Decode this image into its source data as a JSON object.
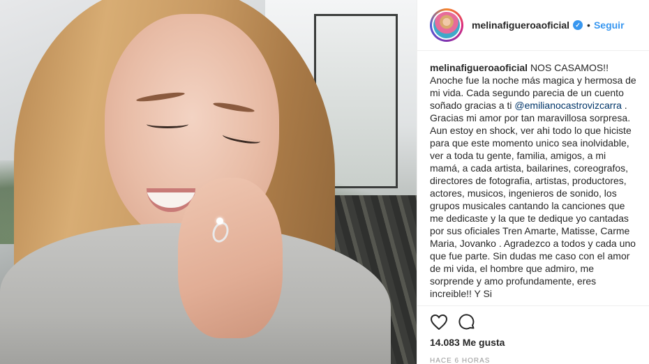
{
  "post": {
    "username": "melinafigueroaoficial",
    "verified_badge": "verified-check-icon",
    "separator": "•",
    "follow_label": "Seguir"
  },
  "caption": {
    "username": "melinafigueroaoficial",
    "text_before_mention": "NOS CASAMOS!! Anoche fue la noche más magica y hermosa de mi vida. Cada segundo parecia de un cuento soñado gracias a ti",
    "mention": "@emilianocastrovizcarra",
    "text_after_mention": ". Gracias mi amor por tan maravillosa sorpresa. Aun estoy en shock, ver ahi todo lo que hiciste para que este momento unico sea inolvidable, ver a toda tu gente, familia, amigos, a mi mamá, a cada artista, bailarines, coreografos, directores de fotografia, artistas, productores, actores, musicos, ingenieros de sonido, los grupos musicales cantando la canciones que me dedicaste y la que te dedique yo cantadas por sus oficiales Tren Amarte, Matisse, Carme Maria, Jovanko . Agradezco a todos y cada uno que fue parte. Sin dudas me caso con el amor de mi vida, el hombre que admiro, me sorprende y amo profundamente, eres increible!! Y Si"
  },
  "actions": {
    "like_icon": "heart-icon",
    "comment_icon": "comment-icon",
    "likes_text": "14.083 Me gusta",
    "time_text": "HACE 6 HORAS"
  },
  "colors": {
    "accent": "#3897f0",
    "mention": "#003569",
    "text": "#262626",
    "muted": "#999999"
  }
}
